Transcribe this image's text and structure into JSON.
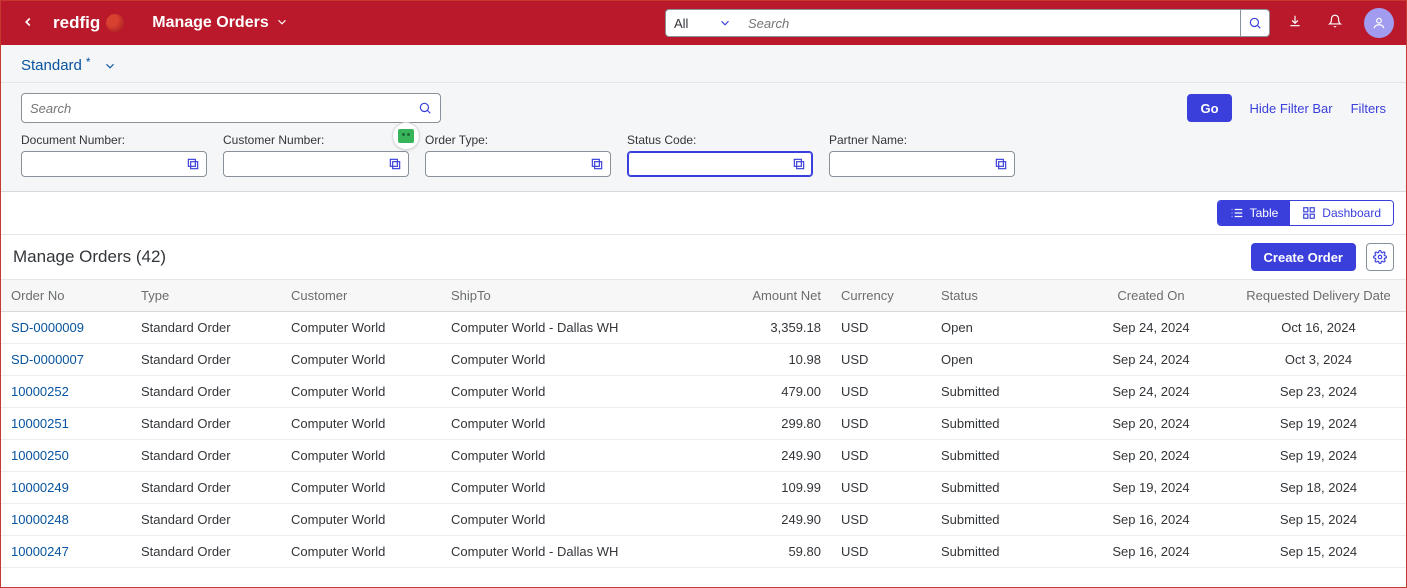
{
  "header": {
    "brand": "redfig",
    "title": "Manage Orders",
    "search_scope": "All",
    "search_placeholder": "Search"
  },
  "variant": {
    "name": "Standard",
    "modified": "*"
  },
  "filterbar": {
    "search_placeholder": "Search",
    "go": "Go",
    "hide": "Hide Filter Bar",
    "filters": "Filters",
    "fields": [
      {
        "label": "Document Number:"
      },
      {
        "label": "Customer Number:"
      },
      {
        "label": "Order Type:"
      },
      {
        "label": "Status Code:"
      },
      {
        "label": "Partner Name:"
      }
    ]
  },
  "view": {
    "table": "Table",
    "dashboard": "Dashboard"
  },
  "table": {
    "title": "Manage Orders (42)",
    "create": "Create Order",
    "columns": [
      "Order No",
      "Type",
      "Customer",
      "ShipTo",
      "Amount Net",
      "Currency",
      "Status",
      "Created On",
      "Requested Delivery Date"
    ],
    "rows": [
      {
        "order": "SD-0000009",
        "type": "Standard Order",
        "cust": "Computer World",
        "ship": "Computer World - Dallas WH",
        "amt": "3,359.18",
        "curr": "USD",
        "status": "Open",
        "created": "Sep 24, 2024",
        "req": "Oct 16, 2024"
      },
      {
        "order": "SD-0000007",
        "type": "Standard Order",
        "cust": "Computer World",
        "ship": "Computer World",
        "amt": "10.98",
        "curr": "USD",
        "status": "Open",
        "created": "Sep 24, 2024",
        "req": "Oct 3, 2024"
      },
      {
        "order": "10000252",
        "type": "Standard Order",
        "cust": "Computer World",
        "ship": "Computer World",
        "amt": "479.00",
        "curr": "USD",
        "status": "Submitted",
        "created": "Sep 24, 2024",
        "req": "Sep 23, 2024"
      },
      {
        "order": "10000251",
        "type": "Standard Order",
        "cust": "Computer World",
        "ship": "Computer World",
        "amt": "299.80",
        "curr": "USD",
        "status": "Submitted",
        "created": "Sep 20, 2024",
        "req": "Sep 19, 2024"
      },
      {
        "order": "10000250",
        "type": "Standard Order",
        "cust": "Computer World",
        "ship": "Computer World",
        "amt": "249.90",
        "curr": "USD",
        "status": "Submitted",
        "created": "Sep 20, 2024",
        "req": "Sep 19, 2024"
      },
      {
        "order": "10000249",
        "type": "Standard Order",
        "cust": "Computer World",
        "ship": "Computer World",
        "amt": "109.99",
        "curr": "USD",
        "status": "Submitted",
        "created": "Sep 19, 2024",
        "req": "Sep 18, 2024"
      },
      {
        "order": "10000248",
        "type": "Standard Order",
        "cust": "Computer World",
        "ship": "Computer World",
        "amt": "249.90",
        "curr": "USD",
        "status": "Submitted",
        "created": "Sep 16, 2024",
        "req": "Sep 15, 2024"
      },
      {
        "order": "10000247",
        "type": "Standard Order",
        "cust": "Computer World",
        "ship": "Computer World - Dallas WH",
        "amt": "59.80",
        "curr": "USD",
        "status": "Submitted",
        "created": "Sep 16, 2024",
        "req": "Sep 15, 2024"
      }
    ]
  }
}
